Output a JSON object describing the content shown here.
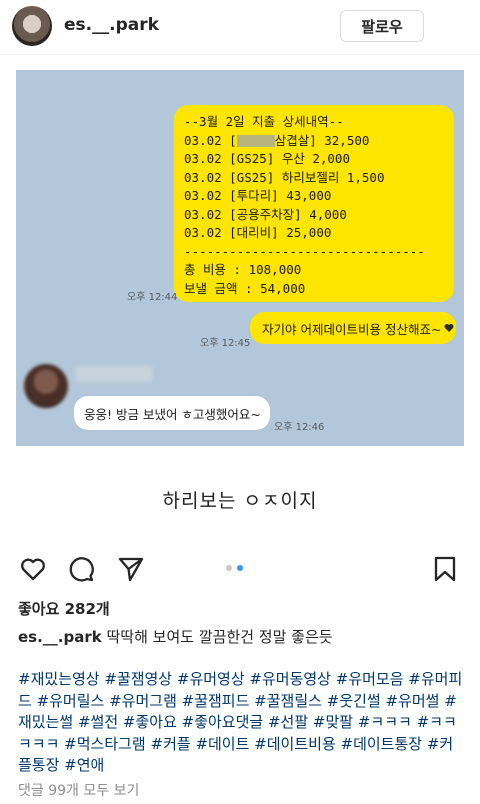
{
  "header": {
    "username": "es.__.park",
    "follow_label": "팔로우"
  },
  "chat": {
    "receipt_lines": [
      "--3월 2일 지출 상세내역--",
      "03.02 [",
      "03.02 [GS25] 우산 2,000",
      "03.02 [GS25] 하리보젤리 1,500",
      "03.02 [투다리] 43,000",
      "03.02 [공용주차장] 4,000",
      "03.02 [대리비] 25,000",
      "--------------------------------",
      "총 비용 : 108,000",
      "보낼 금액 : 54,000"
    ],
    "receipt_line2_suffix": "삼겹살] 32,500",
    "time_1": "오후 12:44",
    "reply_text": "자기야 어제데이트비용 정산해죠~",
    "time_2": "오후 12:45",
    "incoming_text": "웅웅! 방금 보냈어 ㅎ고생했어요~",
    "time_3": "오후 12:46"
  },
  "media_caption": "하리보는 ㅇㅈ이지",
  "post": {
    "likes": "좋아요 282개",
    "caption_user": "es.__.park",
    "caption_text": " 딱딱해 보여도 깔끔한건 정말 좋은듯",
    "hashtags": "#재밌는영상 #꿀잼영상 #유머영상 #유머동영상 #유머모음 #유머피드 #유머릴스 #유머그램 #꿀잼피드 #꿀잼릴스 #웃긴썰 #유머썰 #재밌는썰 #썰전 #좋아요 #좋아요댓글 #선팔 #맞팔 #ㅋㅋㅋ #ㅋㅋㅋㅋㅋ #먹스타그램 #커플 #데이트 #데이트비용 #데이트통장 #커플통장 #연애",
    "comments_link": "댓글 99개 모두 보기"
  },
  "colors": {
    "kakao_bg": "#b2c7d9",
    "bubble_yellow": "#fee500",
    "hashtag_blue": "#00376b",
    "dot_active": "#3897f0"
  }
}
